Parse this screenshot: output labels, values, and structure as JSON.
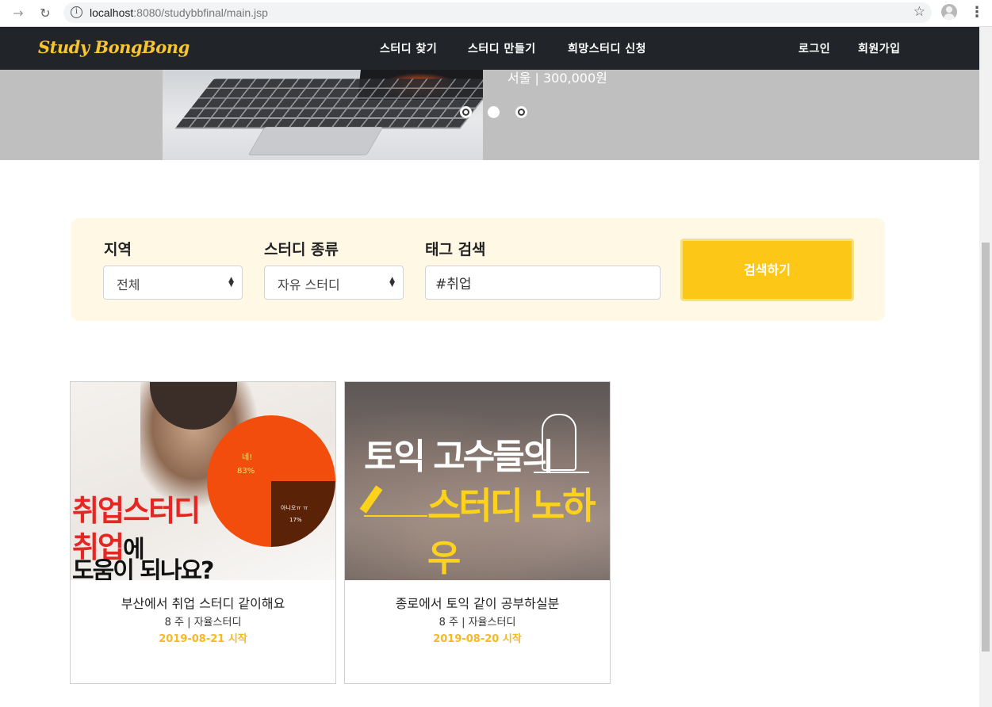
{
  "browser": {
    "url_host": "localhost",
    "url_rest": ":8080/studybbfinal/main.jsp"
  },
  "navbar": {
    "brand": "Study BongBong",
    "links": [
      "스터디 찾기",
      "스터디 만들기",
      "희망스터디 신청"
    ],
    "auth": [
      "로그인",
      "회원가입"
    ]
  },
  "hero": {
    "caption": "서울 | 300,000원",
    "slide_count": 3,
    "active_slide": 2
  },
  "search": {
    "region_label": "지역",
    "region_value": "전체",
    "type_label": "스터디 종류",
    "type_value": "자유 스터디",
    "tag_label": "태그 검색",
    "tag_value": "#취업",
    "button_label": "검색하기"
  },
  "cards": [
    {
      "title": "부산에서 취업 스터디 같이해요",
      "meta": "8 주 | 자율스터디",
      "start": "2019-08-21 시작",
      "image": {
        "headline_red_1": "취업스터디",
        "headline_red_2": "취업",
        "headline_black_2": "에",
        "headline_black_3": "도움이 되나요?",
        "pie_yes_label": "네!",
        "pie_yes_value": "83%",
        "pie_no_label": "아니오ㅠ ㅠ",
        "pie_no_value": "17%"
      }
    },
    {
      "title": "종로에서 토익 같이 공부하실분",
      "meta": "8 주 | 자율스터디",
      "start": "2019-08-20 시작",
      "image": {
        "line1": "토익 고수들의",
        "line2": "스터디 노하우"
      }
    }
  ],
  "colors": {
    "navbar": "#212529",
    "brand": "#f7c533",
    "accent": "#fdc718",
    "panel": "#fff8e5",
    "start_date": "#f5b923"
  }
}
